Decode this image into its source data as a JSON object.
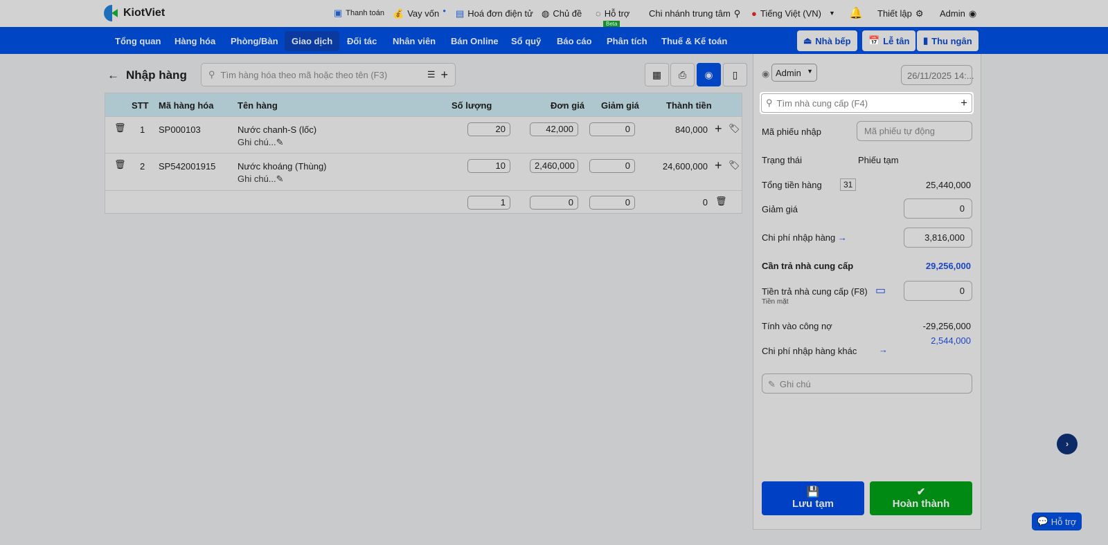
{
  "brand": "KiotViet",
  "topbar": {
    "payment": "Thanh toán",
    "loan": "Vay vốn",
    "einvoice": "Hoá đơn điện tử",
    "theme": "Chủ đề",
    "support": "Hỗ trợ",
    "beta": "Beta",
    "branch": "Chi nhánh trung tâm",
    "language": "Tiếng Việt (VN)",
    "settings": "Thiết lập",
    "user": "Admin"
  },
  "nav": {
    "items": [
      "Tổng quan",
      "Hàng hóa",
      "Phòng/Bàn",
      "Giao dịch",
      "Đối tác",
      "Nhân viên",
      "Bán Online",
      "Sổ quỹ",
      "Báo cáo",
      "Phân tích",
      "Thuế & Kế toán"
    ],
    "active": "Giao dịch",
    "kitchen": "Nhà bếp",
    "reception": "Lễ tân",
    "cashier": "Thu ngân"
  },
  "page": {
    "title": "Nhập hàng",
    "search_placeholder": "Tìm hàng hóa theo mã hoặc theo tên (F3)"
  },
  "table": {
    "headers": {
      "stt": "STT",
      "code": "Mã hàng hóa",
      "name": "Tên hàng",
      "qty": "Số lượng",
      "price": "Đơn giá",
      "discount": "Giảm giá",
      "total": "Thành tiền"
    },
    "rows": [
      {
        "stt": "1",
        "code": "SP000103",
        "name": "Nước chanh-S (lốc)",
        "note": "Ghi chú...",
        "qty": "20",
        "price": "42,000",
        "discount": "0",
        "total": "840,000"
      },
      {
        "stt": "2",
        "code": "SP542001915",
        "name": "Nước khoáng (Thùng)",
        "note": "Ghi chú...",
        "qty": "10",
        "price": "2,460,000",
        "discount": "0",
        "total": "24,600,000"
      }
    ],
    "new_row": {
      "qty": "1",
      "price": "0",
      "discount": "0",
      "total": "0"
    }
  },
  "panel": {
    "user": "Admin",
    "date": "26/11/2025 14:...",
    "supplier_placeholder": "Tìm nhà cung cấp (F4)",
    "code_label": "Mã phiếu nhập",
    "code_placeholder": "Mã phiếu tự động",
    "status_label": "Trạng thái",
    "status": "Phiếu tạm",
    "subtotal_label": "Tổng tiền hàng",
    "subtotal_count": "31",
    "subtotal": "25,440,000",
    "discount_label": "Giảm giá",
    "discount": "0",
    "cost_label": "Chi phí nhập hàng",
    "cost": "3,816,000",
    "payable_label": "Cần trả nhà cung cấp",
    "payable": "29,256,000",
    "paid_label": "Tiền trả nhà cung cấp (F8)",
    "paid_method": "Tiền mặt",
    "paid": "0",
    "debt_label": "Tính vào công nợ",
    "debt": "-29,256,000",
    "other_cost_label": "Chi phí nhập hàng khác",
    "other_cost": "2,544,000",
    "note_placeholder": "Ghi chú",
    "save": "Lưu tạm",
    "complete": "Hoàn thành"
  },
  "help": "Hỗ trợ",
  "colors": {
    "nav": "#0046c4",
    "complete": "#008a14",
    "accent": "#1a45c8"
  }
}
